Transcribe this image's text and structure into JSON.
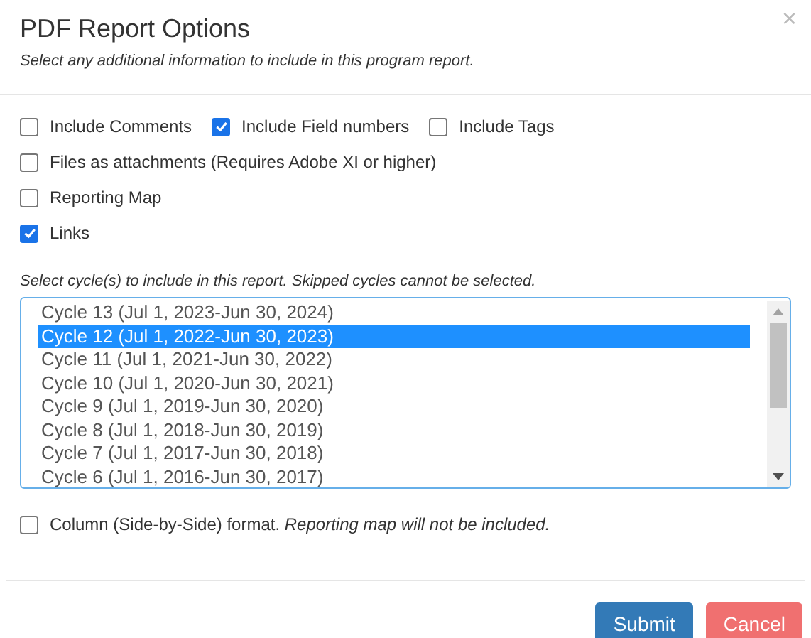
{
  "dialog": {
    "title": "PDF Report Options",
    "subtitle": "Select any additional information to include in this program report.",
    "close": "×"
  },
  "option_rows": [
    [
      {
        "label": "Include Comments",
        "checked": false
      },
      {
        "label": "Include Field numbers",
        "checked": true
      },
      {
        "label": "Include Tags",
        "checked": false
      }
    ],
    [
      {
        "label": "Files as attachments (Requires Adobe XI or higher)",
        "checked": false
      }
    ],
    [
      {
        "label": "Reporting Map",
        "checked": false
      }
    ],
    [
      {
        "label": "Links",
        "checked": true
      }
    ]
  ],
  "cycles": {
    "caption": "Select cycle(s) to include in this report. Skipped cycles cannot be selected.",
    "items": [
      {
        "label": "Cycle 13 (Jul 1, 2023-Jun 30, 2024)",
        "selected": false
      },
      {
        "label": "Cycle 12 (Jul 1, 2022-Jun 30, 2023)",
        "selected": true
      },
      {
        "label": "Cycle 11 (Jul 1, 2021-Jun 30, 2022)",
        "selected": false
      },
      {
        "label": "Cycle 10 (Jul 1, 2020-Jun 30, 2021)",
        "selected": false
      },
      {
        "label": "Cycle 9 (Jul 1, 2019-Jun 30, 2020)",
        "selected": false
      },
      {
        "label": "Cycle 8 (Jul 1, 2018-Jun 30, 2019)",
        "selected": false
      },
      {
        "label": "Cycle 7 (Jul 1, 2017-Jun 30, 2018)",
        "selected": false
      },
      {
        "label": "Cycle 6 (Jul 1, 2016-Jun 30, 2017)",
        "selected": false
      }
    ]
  },
  "column_format": {
    "label": "Column (Side-by-Side) format. *Reporting map will not be included.*",
    "checked": false
  },
  "buttons": {
    "submit": "Submit",
    "cancel": "Cancel"
  }
}
